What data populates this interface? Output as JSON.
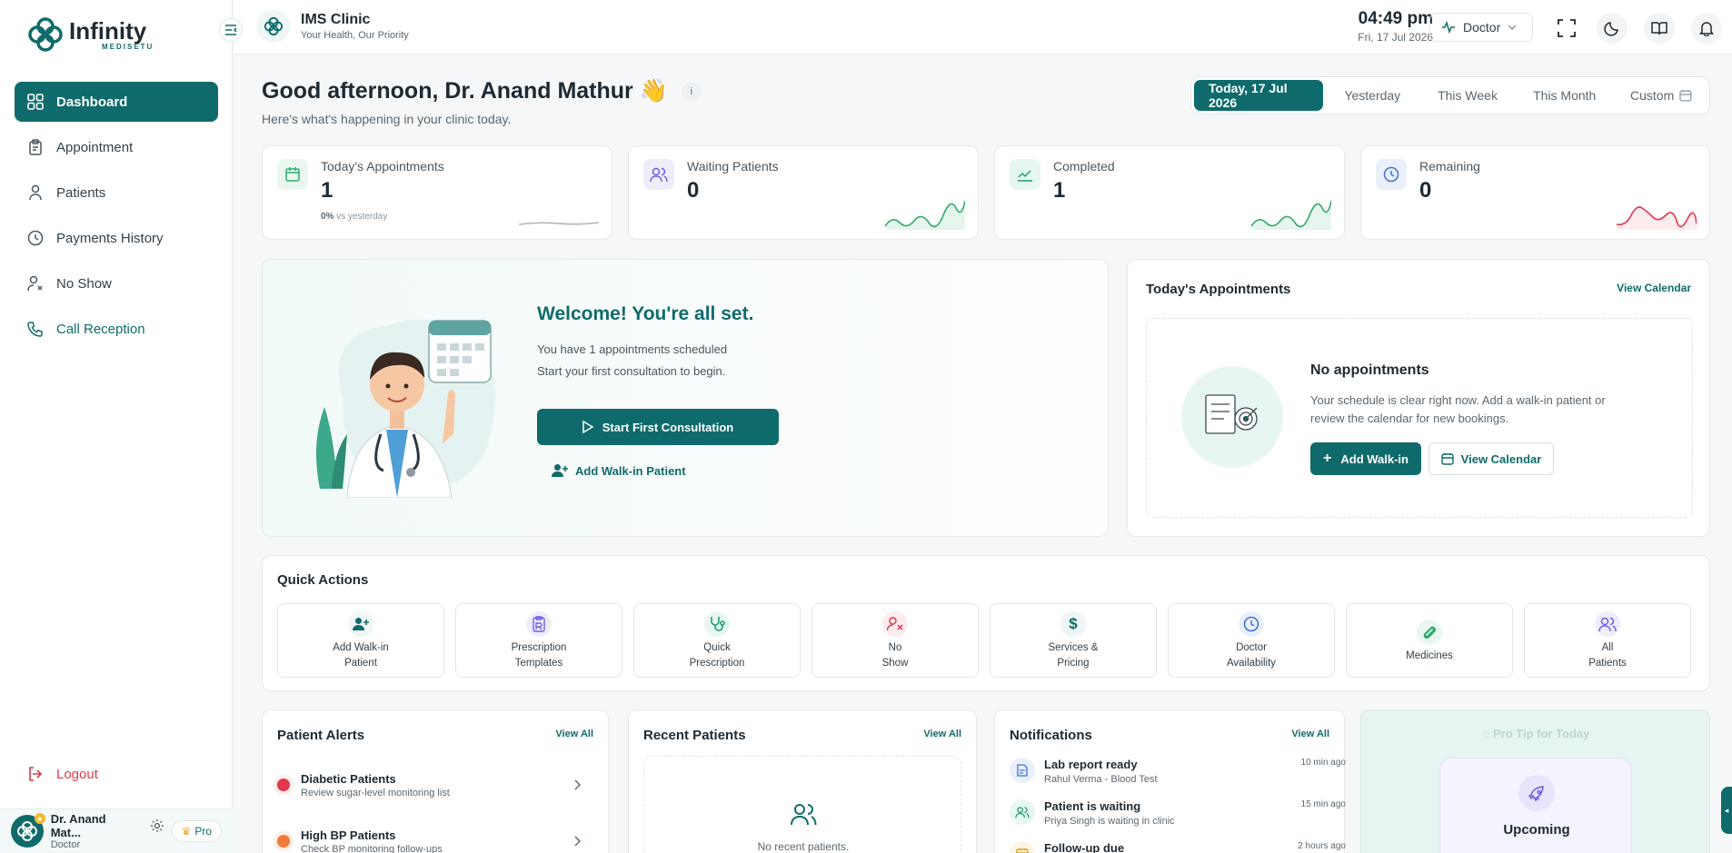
{
  "brand": {
    "name": "Infinity",
    "sub": "MEDISETU"
  },
  "sidebar": {
    "items": [
      {
        "label": "Dashboard",
        "icon": "grid-icon",
        "state": "active"
      },
      {
        "label": "Appointment",
        "icon": "clipboard-icon"
      },
      {
        "label": "Patients",
        "icon": "patients-icon"
      },
      {
        "label": "Payments History",
        "icon": "history-icon"
      },
      {
        "label": "No Show",
        "icon": "user-x-icon"
      },
      {
        "label": "Call Reception",
        "icon": "phone-icon"
      }
    ],
    "logout": "Logout"
  },
  "profile": {
    "name": "Dr. Anand Mat...",
    "role": "Doctor",
    "badge": "Pro"
  },
  "topbar": {
    "clinic_name": "IMS Clinic",
    "tagline": "Your Health, Our Priority",
    "time": "04:49 pm",
    "date": "Fri, 17 Jul 2026",
    "role": "Doctor"
  },
  "header": {
    "greeting": "Good afternoon, Dr. Anand Mathur",
    "emoji": "👋",
    "subtitle": "Here's what's happening in your clinic today.",
    "ranges": [
      "Today, 17 Jul 2026",
      "Yesterday",
      "This Week",
      "This Month",
      "Custom"
    ],
    "active_range": 0
  },
  "stats": [
    {
      "label": "Today's Appointments",
      "value": "1",
      "delta": "0%",
      "delta_text": "vs yesterday",
      "color": "#2eaa6b",
      "bg": "#e9f7f0"
    },
    {
      "label": "Waiting Patients",
      "value": "0",
      "color": "#6c5ce7",
      "bg": "#efedfb"
    },
    {
      "label": "Completed",
      "value": "1",
      "color": "#1e9e6a",
      "bg": "#e6f6f0"
    },
    {
      "label": "Remaining",
      "value": "0",
      "color": "#3b6fd8",
      "bg": "#eaf0fb"
    }
  ],
  "welcome": {
    "title": "Welcome! You're all set.",
    "line1": "You have 1 appointments scheduled",
    "line2": "Start your first consultation to begin.",
    "start_btn": "Start First Consultation",
    "walkin": "Add Walk-in Patient"
  },
  "appointments": {
    "title": "Today's Appointments",
    "view_calendar": "View Calendar",
    "empty_title": "No appointments",
    "empty_text1": "Your schedule is clear right now. Add a walk-in patient or",
    "empty_text2": "review the calendar for new bookings.",
    "add_walkin": "Add Walk-in",
    "view_calendar_btn": "View Calendar"
  },
  "quick_actions": {
    "title": "Quick Actions",
    "items": [
      {
        "l1": "Add Walk-in",
        "l2": "Patient",
        "icon": "user-plus-icon",
        "color": "#0f6b6b"
      },
      {
        "l1": "Prescription",
        "l2": "Templates",
        "icon": "prescription-icon",
        "color": "#6c5ce7"
      },
      {
        "l1": "Quick",
        "l2": "Prescription",
        "icon": "stethoscope-icon",
        "color": "#1e9e6a"
      },
      {
        "l1": "No",
        "l2": "Show",
        "icon": "user-x-icon",
        "color": "#e0394b"
      },
      {
        "l1": "Services &",
        "l2": "Pricing",
        "icon": "dollar-icon",
        "color": "#0f6b6b"
      },
      {
        "l1": "Doctor",
        "l2": "Availability",
        "icon": "clock-icon",
        "color": "#3b6fd8"
      },
      {
        "l1": "Medicines",
        "l2": "",
        "icon": "pill-icon",
        "color": "#2eaa6b"
      },
      {
        "l1": "All",
        "l2": "Patients",
        "icon": "users-icon",
        "color": "#6c5ce7"
      }
    ]
  },
  "alerts": {
    "title": "Patient Alerts",
    "view_all": "View All",
    "items": [
      {
        "title": "Diabetic Patients",
        "sub": "Review sugar-level monitoring list",
        "color": "#e0394b"
      },
      {
        "title": "High BP Patients",
        "sub": "Check BP monitoring follow-ups",
        "color": "#f07a3c"
      }
    ]
  },
  "recent": {
    "title": "Recent Patients",
    "view_all": "View All",
    "empty": "No recent patients."
  },
  "notifications": {
    "title": "Notifications",
    "view_all": "View All",
    "items": [
      {
        "title": "Lab report ready",
        "sub": "Rahul Verma - Blood Test",
        "time": "10 min ago",
        "color": "#3b6fd8",
        "bg": "#eaf0fb"
      },
      {
        "title": "Patient is waiting",
        "sub": "Priya Singh is waiting in clinic",
        "time": "15 min ago",
        "color": "#1e9e6a",
        "bg": "#e6f6f0"
      },
      {
        "title": "Follow-up due",
        "sub": "",
        "time": "2 hours ago",
        "color": "#e0a020",
        "bg": "#fdf4e2"
      }
    ]
  },
  "protip": {
    "label": "Pro Tip for Today",
    "title": "Upcoming"
  }
}
